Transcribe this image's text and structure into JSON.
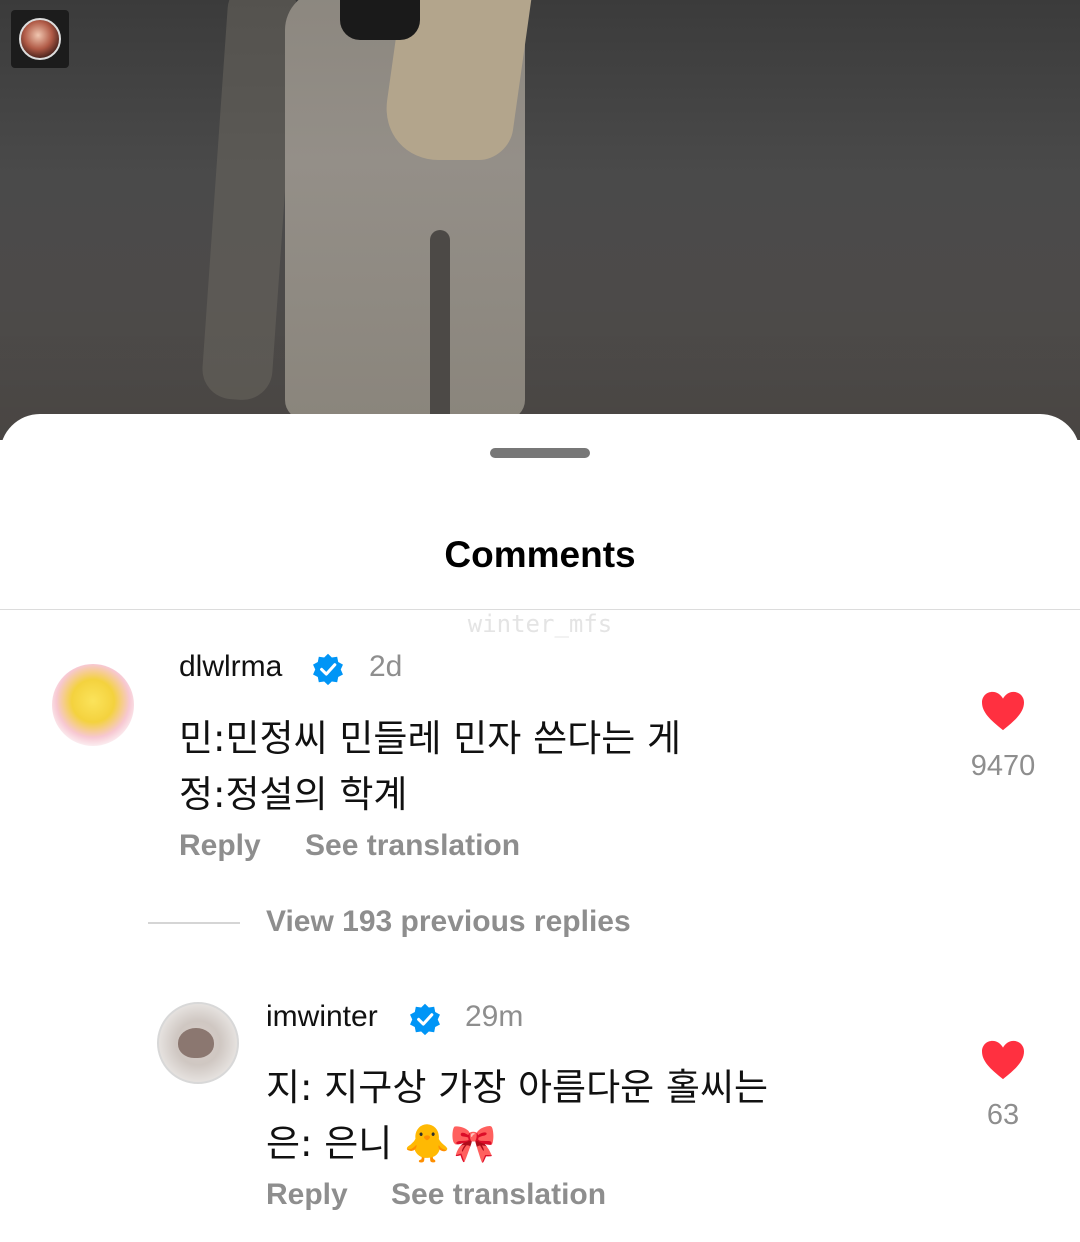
{
  "sheet": {
    "title": "Comments",
    "watermark": "winter_mfs"
  },
  "comments": [
    {
      "username": "dlwlrma",
      "verified": true,
      "time": "2d",
      "lines": [
        "민:민정씨 민들레 민자 쓴다는 게",
        "정:정설의 학계"
      ],
      "likes": "9470",
      "reply_label": "Reply",
      "translate_label": "See translation"
    },
    {
      "username": "imwinter",
      "verified": true,
      "time": "29m",
      "lines": [
        "지: 지구상 가장 아름다운 홀씨는",
        "은: 은니 🐥🎀"
      ],
      "likes": "63",
      "reply_label": "Reply",
      "translate_label": "See translation"
    }
  ],
  "replies": {
    "view_label": "View 193 previous replies"
  },
  "colors": {
    "heart": "#ff3040",
    "verified": "#0095f6",
    "muted_text": "#8e8e8e"
  },
  "icons": {
    "verified": "verified-badge-icon",
    "heart": "heart-icon"
  }
}
